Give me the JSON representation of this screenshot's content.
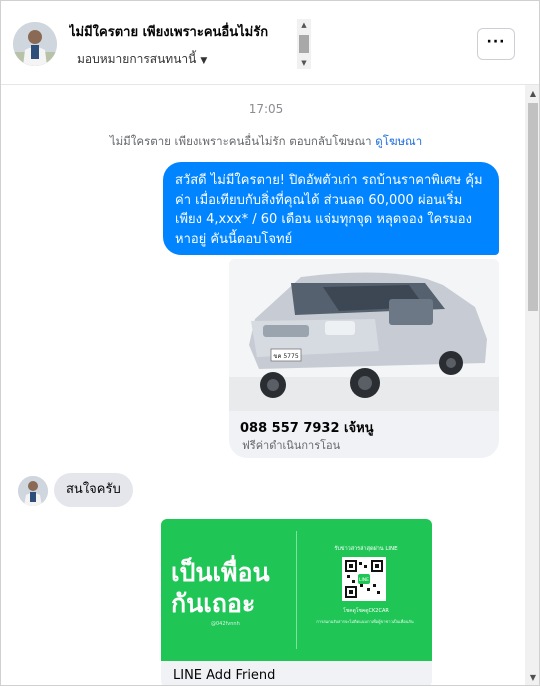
{
  "header": {
    "title": "ไม่มีใครตาย เพียงเพราะคนอื่นไม่รัก",
    "subtitle": "มอบหมายการสนทนานี้",
    "more_icon": "more-dots-icon"
  },
  "conversation": {
    "timestamp": "17:05",
    "reply_note": "ไม่มีใครตาย เพียงเพราะคนอื่นไม่รัก ตอบกลับโฆษณา",
    "view_ad_link": "ดูโฆษณา",
    "outgoing_message": "สวัสดี ไม่มีใครตาย! ปิดอัพตัวเก่า รถบ้านราคาพิเศษ คุ้มค่า เมื่อเทียบกับสิ่งที่คุณได้  ส่วนลด 60,000 ผ่อนเริ่มเพียง 4,xxx* / 60 เดือน แจ่มทุกจุด หลุดจอง ใครมองหาอยู่ คันนี้ตอบโจทย์",
    "ad_card": {
      "plate": "ขค 5775",
      "phone_name": "088 557 7932 เจ้หนู",
      "caption": "ฟรีค่าดำเนินการโอน"
    },
    "incoming_message": "สนใจครับ",
    "line_card": {
      "headline_line1": "เป็นเพื่อน",
      "headline_line2": "กันเถอะ",
      "handle": "@042fvnnh",
      "right_title": "รับข่าวสารล่าสุดผ่าน LINE",
      "qr_badge": "LINE",
      "right_sub": "โชคดูโชคดูCK2CAR",
      "right_note": "การสแกนรับสารจะไม่ติดแนบกาเพื่อผู้ขาชาวเป็นเพื่อนกัน",
      "label": "LINE Add Friend"
    }
  },
  "colors": {
    "outgoing_bubble": "#0084ff",
    "incoming_bubble": "#e4e6eb",
    "line_green": "#1fc656",
    "link": "#216fdb"
  }
}
